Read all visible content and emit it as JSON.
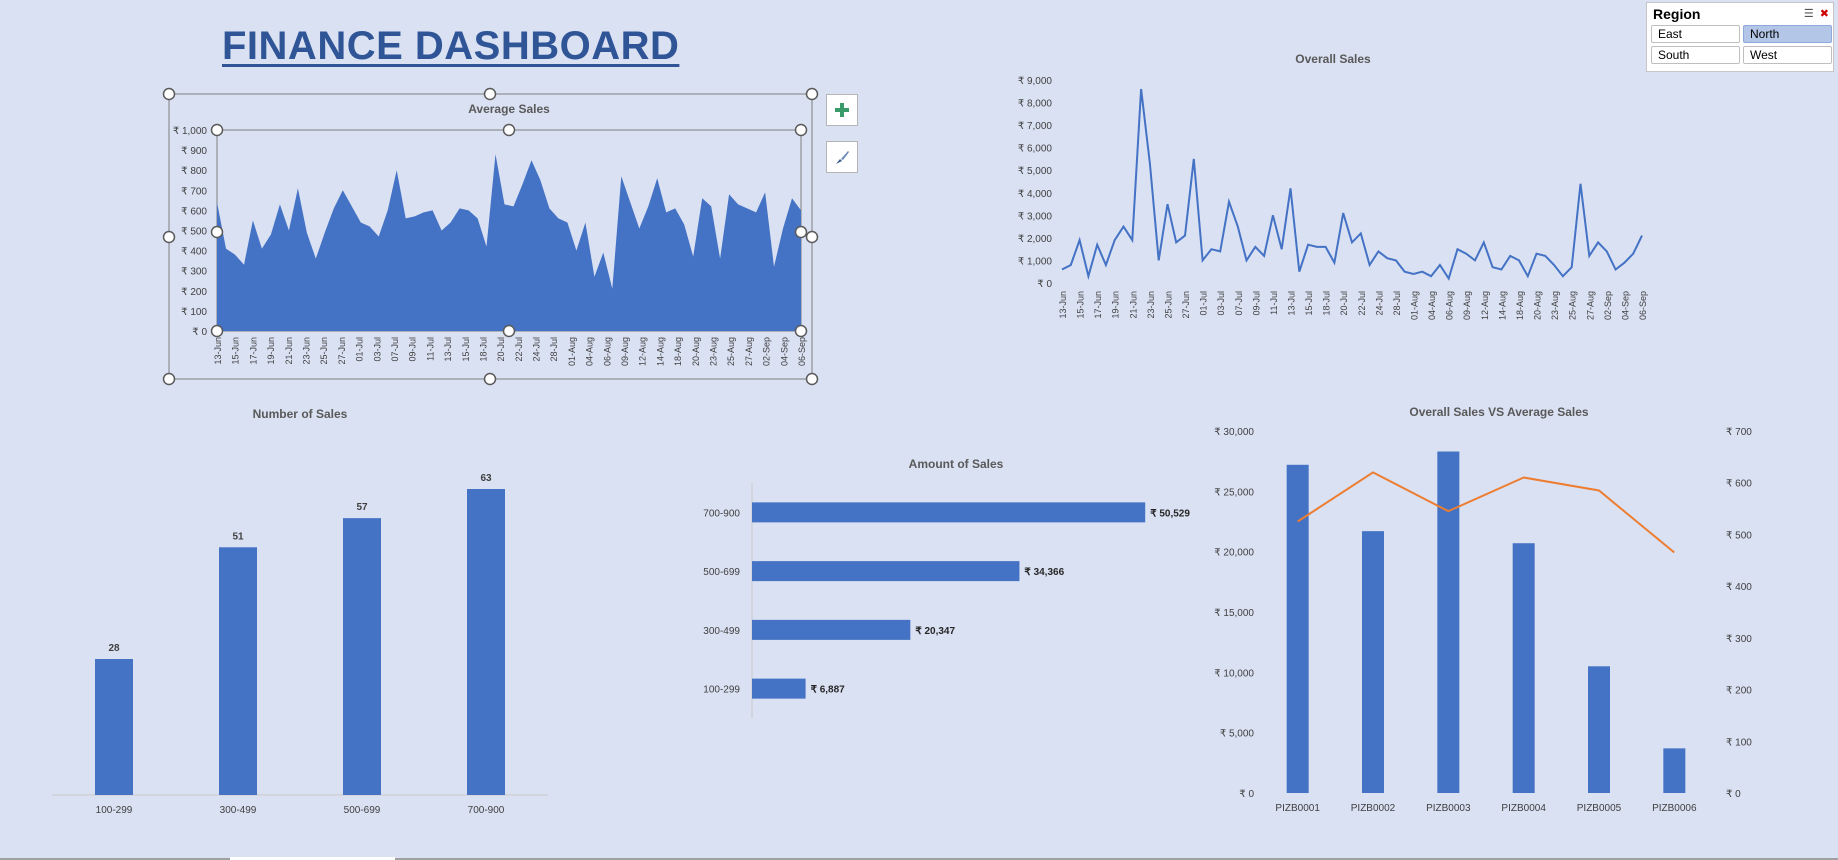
{
  "dashboard": {
    "title": "FINANCE DASHBOARD"
  },
  "slicer": {
    "title": "Region",
    "items": [
      {
        "label": "East",
        "selected": false
      },
      {
        "label": "North",
        "selected": true
      },
      {
        "label": "South",
        "selected": false
      },
      {
        "label": "West",
        "selected": false
      }
    ]
  },
  "colors": {
    "bar": "#4472c4",
    "line": "#4472c4",
    "secondary_line": "#ed7d31",
    "background": "#dae1f3",
    "title": "#2f5597"
  },
  "icons": {
    "add_element": "plus-icon",
    "chart_styles": "brush-icon",
    "multi_select": "multi-select-icon",
    "clear_filter": "clear-filter-icon"
  },
  "chart_data": [
    {
      "id": "average-sales",
      "type": "area",
      "title": "Average Sales",
      "ylim": [
        0,
        1000
      ],
      "yticks": [
        "₹ 0",
        "₹ 100",
        "₹ 200",
        "₹ 300",
        "₹ 400",
        "₹ 500",
        "₹ 600",
        "₹ 700",
        "₹ 800",
        "₹ 900",
        "₹ 1,000"
      ],
      "xticks": [
        "13-Jun",
        "15-Jun",
        "17-Jun",
        "19-Jun",
        "21-Jun",
        "23-Jun",
        "25-Jun",
        "27-Jun",
        "01-Jul",
        "03-Jul",
        "07-Jul",
        "09-Jul",
        "11-Jul",
        "13-Jul",
        "15-Jul",
        "18-Jul",
        "20-Jul",
        "22-Jul",
        "24-Jul",
        "28-Jul",
        "01-Aug",
        "04-Aug",
        "06-Aug",
        "09-Aug",
        "12-Aug",
        "14-Aug",
        "18-Aug",
        "20-Aug",
        "23-Aug",
        "25-Aug",
        "27-Aug",
        "02-Sep",
        "04-Sep",
        "06-Sep"
      ],
      "values": [
        640,
        410,
        380,
        330,
        550,
        410,
        480,
        630,
        500,
        710,
        490,
        360,
        490,
        610,
        700,
        620,
        540,
        520,
        470,
        600,
        800,
        560,
        570,
        590,
        600,
        500,
        540,
        610,
        600,
        560,
        420,
        880,
        630,
        620,
        730,
        850,
        750,
        610,
        560,
        540,
        400,
        540,
        270,
        390,
        210,
        770,
        640,
        510,
        620,
        760,
        590,
        610,
        530,
        370,
        660,
        620,
        360,
        680,
        630,
        610,
        590,
        690,
        320,
        510,
        660,
        600
      ],
      "show_selection": true
    },
    {
      "id": "overall-sales",
      "type": "line",
      "title": "Overall Sales",
      "ylim": [
        0,
        9000
      ],
      "yticks": [
        "₹ 0",
        "₹ 1,000",
        "₹ 2,000",
        "₹ 3,000",
        "₹ 4,000",
        "₹ 5,000",
        "₹ 6,000",
        "₹ 7,000",
        "₹ 8,000",
        "₹ 9,000"
      ],
      "xticks": [
        "13-Jun",
        "15-Jun",
        "17-Jun",
        "19-Jun",
        "21-Jun",
        "23-Jun",
        "25-Jun",
        "27-Jun",
        "01-Jul",
        "03-Jul",
        "07-Jul",
        "09-Jul",
        "11-Jul",
        "13-Jul",
        "15-Jul",
        "18-Jul",
        "20-Jul",
        "22-Jul",
        "24-Jul",
        "28-Jul",
        "01-Aug",
        "04-Aug",
        "06-Aug",
        "09-Aug",
        "12-Aug",
        "14-Aug",
        "18-Aug",
        "20-Aug",
        "23-Aug",
        "25-Aug",
        "27-Aug",
        "02-Sep",
        "04-Sep",
        "06-Sep"
      ],
      "values": [
        600,
        800,
        1900,
        300,
        1700,
        800,
        1900,
        2500,
        1900,
        8600,
        5300,
        1000,
        3500,
        1800,
        2100,
        5500,
        1000,
        1500,
        1400,
        3600,
        2500,
        1000,
        1600,
        1200,
        3000,
        1500,
        4200,
        500,
        1700,
        1600,
        1600,
        900,
        3100,
        1800,
        2200,
        800,
        1400,
        1100,
        1000,
        500,
        400,
        500,
        300,
        800,
        200,
        1500,
        1300,
        1000,
        1800,
        700,
        600,
        1200,
        1000,
        300,
        1300,
        1200,
        800,
        300,
        700,
        4400,
        1200,
        1800,
        1400,
        600,
        900,
        1300,
        2100
      ]
    },
    {
      "id": "number-of-sales",
      "type": "bar",
      "title": "Number  of Sales",
      "categories": [
        "100-299",
        "300-499",
        "500-699",
        "700-900"
      ],
      "values": [
        28,
        51,
        57,
        63
      ],
      "data_labels": [
        "28",
        "51",
        "57",
        "63"
      ],
      "ylim": [
        0,
        70
      ]
    },
    {
      "id": "amount-of-sales",
      "type": "bar",
      "orientation": "horizontal",
      "title": "Amount of Sales",
      "categories": [
        "100-299",
        "300-499",
        "500-699",
        "700-900"
      ],
      "values": [
        6887,
        20347,
        34366,
        50529
      ],
      "data_labels": [
        "₹ 6,887",
        "₹ 20,347",
        "₹ 34,366",
        "₹ 50,529"
      ],
      "xlim": [
        0,
        55000
      ]
    },
    {
      "id": "overall-vs-average",
      "type": "bar",
      "title": "Overall Sales VS Average Sales",
      "categories": [
        "PIZB0001",
        "PIZB0002",
        "PIZB0003",
        "PIZB0004",
        "PIZB0005",
        "PIZB0006"
      ],
      "series": [
        {
          "values": [
            27200,
            21700,
            28300,
            20700,
            10500,
            3700
          ],
          "axis": "primary",
          "type": "bar"
        },
        {
          "values": [
            525,
            620,
            545,
            610,
            585,
            465
          ],
          "axis": "secondary",
          "type": "line"
        }
      ],
      "ylim": [
        0,
        30000
      ],
      "yticks": [
        "₹ 0",
        "₹ 5,000",
        "₹ 10,000",
        "₹ 15,000",
        "₹ 20,000",
        "₹ 25,000",
        "₹ 30,000"
      ],
      "y2lim": [
        0,
        700
      ],
      "y2ticks": [
        "₹ 0",
        "₹ 100",
        "₹ 200",
        "₹ 300",
        "₹ 400",
        "₹ 500",
        "₹ 600",
        "₹ 700"
      ]
    }
  ]
}
